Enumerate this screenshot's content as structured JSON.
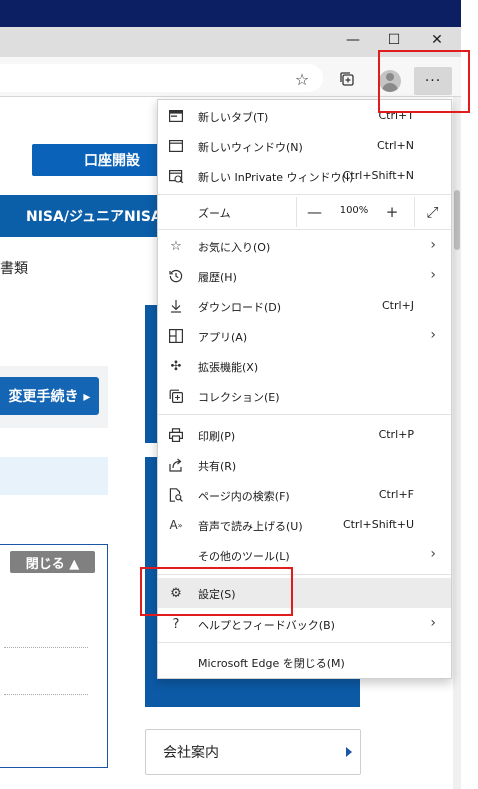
{
  "window": {
    "minimize_glyph": "—",
    "maximize_glyph": "☐",
    "close_glyph": "✕"
  },
  "toolbar": {
    "more_label": "···"
  },
  "page": {
    "koza_button": "口座開設",
    "nisa_bar": "NISA/ジュニアNISA",
    "shorui": "書類",
    "change_button": "変更手続き ▸",
    "close_button": "閉じる ▲",
    "company_link": "会社案内"
  },
  "menu": {
    "items": [
      {
        "label": "新しいタブ(T)",
        "shortcut": "Ctrl+T",
        "icon": "new-tab-icon"
      },
      {
        "label": "新しいウィンドウ(N)",
        "shortcut": "Ctrl+N",
        "icon": "new-window-icon"
      },
      {
        "label": "新しい InPrivate ウィンドウ(I)",
        "shortcut": "Ctrl+Shift+N",
        "icon": "inprivate-icon"
      },
      {
        "label": "お気に入り(O)",
        "shortcut": "",
        "icon": "favorites-icon"
      },
      {
        "label": "履歴(H)",
        "shortcut": "",
        "icon": "history-icon"
      },
      {
        "label": "ダウンロード(D)",
        "shortcut": "Ctrl+J",
        "icon": "download-icon"
      },
      {
        "label": "アプリ(A)",
        "shortcut": "",
        "icon": "apps-icon"
      },
      {
        "label": "拡張機能(X)",
        "shortcut": "",
        "icon": "extensions-icon"
      },
      {
        "label": "コレクション(E)",
        "shortcut": "",
        "icon": "collections-icon"
      },
      {
        "label": "印刷(P)",
        "shortcut": "Ctrl+P",
        "icon": "print-icon"
      },
      {
        "label": "共有(R)",
        "shortcut": "",
        "icon": "share-icon"
      },
      {
        "label": "ページ内の検索(F)",
        "shortcut": "Ctrl+F",
        "icon": "find-icon"
      },
      {
        "label": "音声で読み上げる(U)",
        "shortcut": "Ctrl+Shift+U",
        "icon": "read-aloud-icon"
      },
      {
        "label": "その他のツール(L)",
        "shortcut": "",
        "icon": ""
      },
      {
        "label": "設定(S)",
        "shortcut": "",
        "icon": "settings-icon"
      },
      {
        "label": "ヘルプとフィードバック(B)",
        "shortcut": "",
        "icon": "help-icon"
      },
      {
        "label": "Microsoft Edge を閉じる(M)",
        "shortcut": "",
        "icon": ""
      }
    ],
    "zoom": {
      "label": "ズーム",
      "minus": "—",
      "value": "100%",
      "plus": "+",
      "fullscreen": "⤢"
    }
  },
  "colors": {
    "highlight": "#e21c1c",
    "brand_blue": "#0b5ea8"
  }
}
